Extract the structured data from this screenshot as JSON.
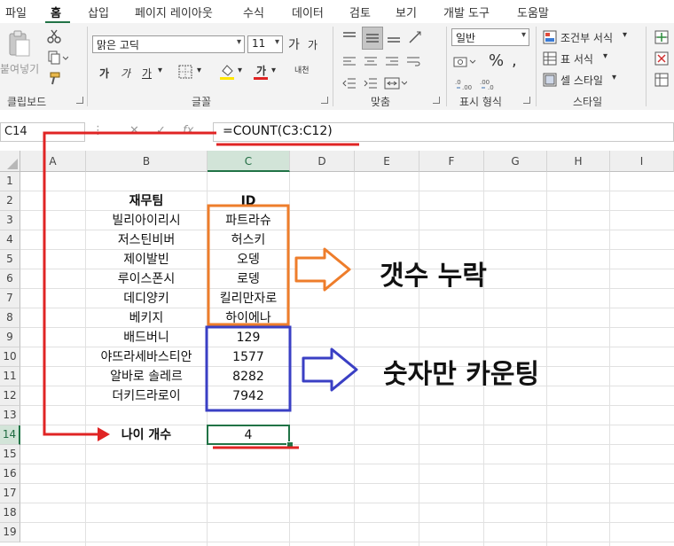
{
  "menu": {
    "items": [
      "파일",
      "홈",
      "삽입",
      "페이지 레이아웃",
      "수식",
      "데이터",
      "검토",
      "보기",
      "개발 도구",
      "도움말"
    ],
    "active": "홈"
  },
  "ribbon": {
    "clipboard": {
      "paste_label": "붙여넣기",
      "group_label": "클립보드"
    },
    "font": {
      "font_name": "맑은 고딕",
      "font_size": "11",
      "grow": "가",
      "shrink": "가",
      "bold": "가",
      "italic": "가",
      "underline": "가",
      "font_color_glyph": "가",
      "phonetic": "내천",
      "group_label": "글꼴"
    },
    "alignment": {
      "group_label": "맞춤"
    },
    "number": {
      "format": "일반",
      "group_label": "표시 형식"
    },
    "styles": {
      "conditional": "조건부 서식",
      "table": "표 서식",
      "cell": "셀 스타일",
      "group_label": "스타일"
    }
  },
  "formula_bar": {
    "name_box": "C14",
    "fx": "fx",
    "formula": "=COUNT(C3:C12)"
  },
  "sheet": {
    "columns": [
      "A",
      "B",
      "C",
      "D",
      "E",
      "F",
      "G",
      "H",
      "I"
    ],
    "selected_column": "C",
    "rows": [
      "1",
      "2",
      "3",
      "4",
      "5",
      "6",
      "7",
      "8",
      "9",
      "10",
      "11",
      "12",
      "13",
      "14",
      "15",
      "16",
      "17",
      "18",
      "19"
    ],
    "selected_row": "14",
    "header": {
      "name": "재무팀",
      "id": "ID"
    },
    "records": [
      {
        "name": "빌리아이리시",
        "id": "파트라슈"
      },
      {
        "name": "저스틴비버",
        "id": "허스키"
      },
      {
        "name": "제이발빈",
        "id": "오뎅"
      },
      {
        "name": "루이스폰시",
        "id": "로뎅"
      },
      {
        "name": "데디양키",
        "id": "킬리만자로"
      },
      {
        "name": "베키지",
        "id": "하이에나"
      },
      {
        "name": "배드버니",
        "id": "129"
      },
      {
        "name": "야뜨라세바스티안",
        "id": "1577"
      },
      {
        "name": "알바로 솔레르",
        "id": "8282"
      },
      {
        "name": "더키드라로이",
        "id": "7942"
      }
    ],
    "result": {
      "label": "나이 개수",
      "value": "4"
    }
  },
  "annotations": {
    "missing": "갯수 누락",
    "counted": "숫자만 카운팅",
    "colors": {
      "red": "#e02424",
      "orange": "#ee7d2b",
      "blue": "#3a3fc4"
    }
  }
}
